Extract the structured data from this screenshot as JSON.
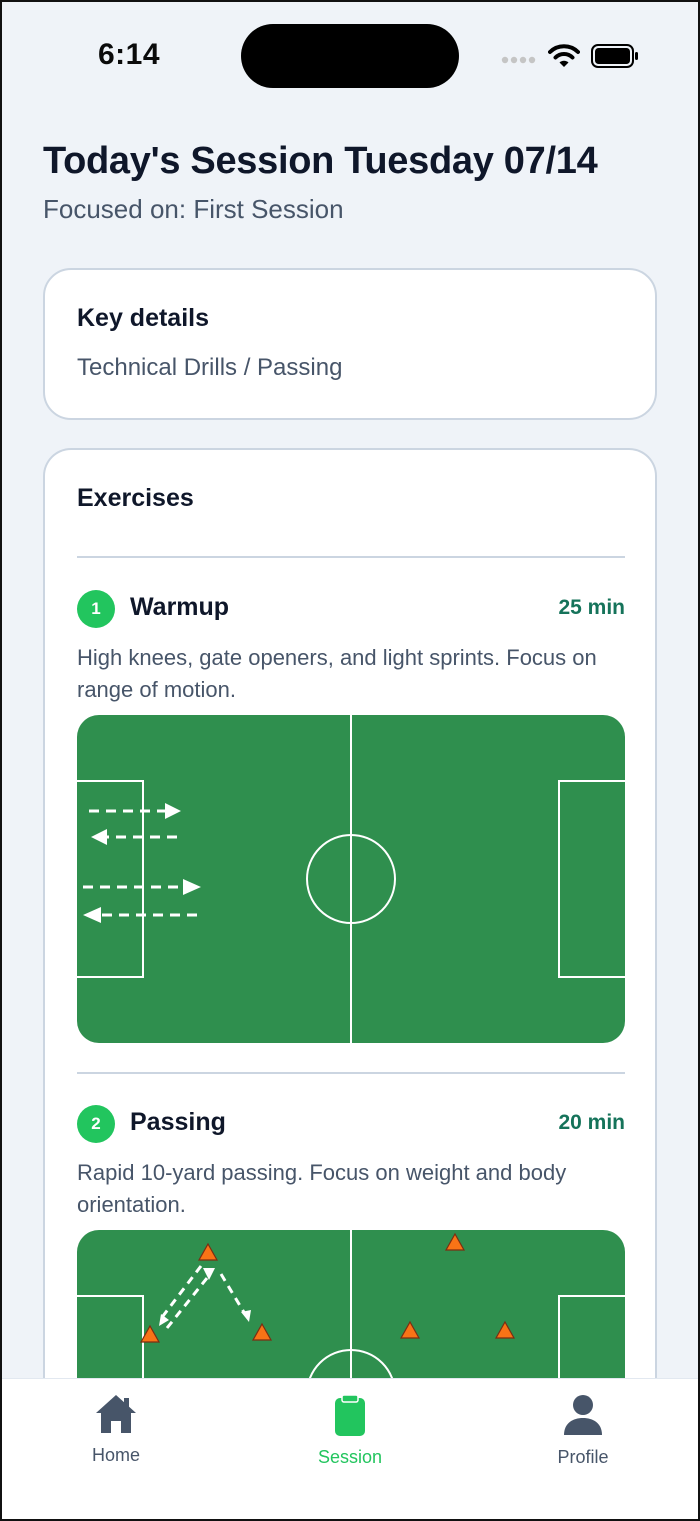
{
  "status_bar": {
    "time": "6:14"
  },
  "header": {
    "title": "Today's Session Tuesday 07/14",
    "subtitle": "Focused on: First Session"
  },
  "key_details": {
    "heading": "Key details",
    "text": "Technical Drills / Passing"
  },
  "exercises": {
    "heading": "Exercises",
    "items": [
      {
        "number": "1",
        "name": "Warmup",
        "duration": "25 min",
        "description": "High knees, gate openers, and light sprints. Focus on range of motion."
      },
      {
        "number": "2",
        "name": "Passing",
        "duration": "20 min",
        "description": "Rapid 10-yard passing. Focus on weight and body orientation."
      }
    ]
  },
  "nav": {
    "items": [
      {
        "label": "Home",
        "icon": "home-icon"
      },
      {
        "label": "Session",
        "icon": "clipboard-icon",
        "active": true
      },
      {
        "label": "Profile",
        "icon": "person-icon"
      }
    ]
  },
  "colors": {
    "background": "#eff3f8",
    "accent": "#22c55e",
    "pitch": "#2f8f4e",
    "duration_text": "#15735a",
    "cone": "#f97316"
  }
}
